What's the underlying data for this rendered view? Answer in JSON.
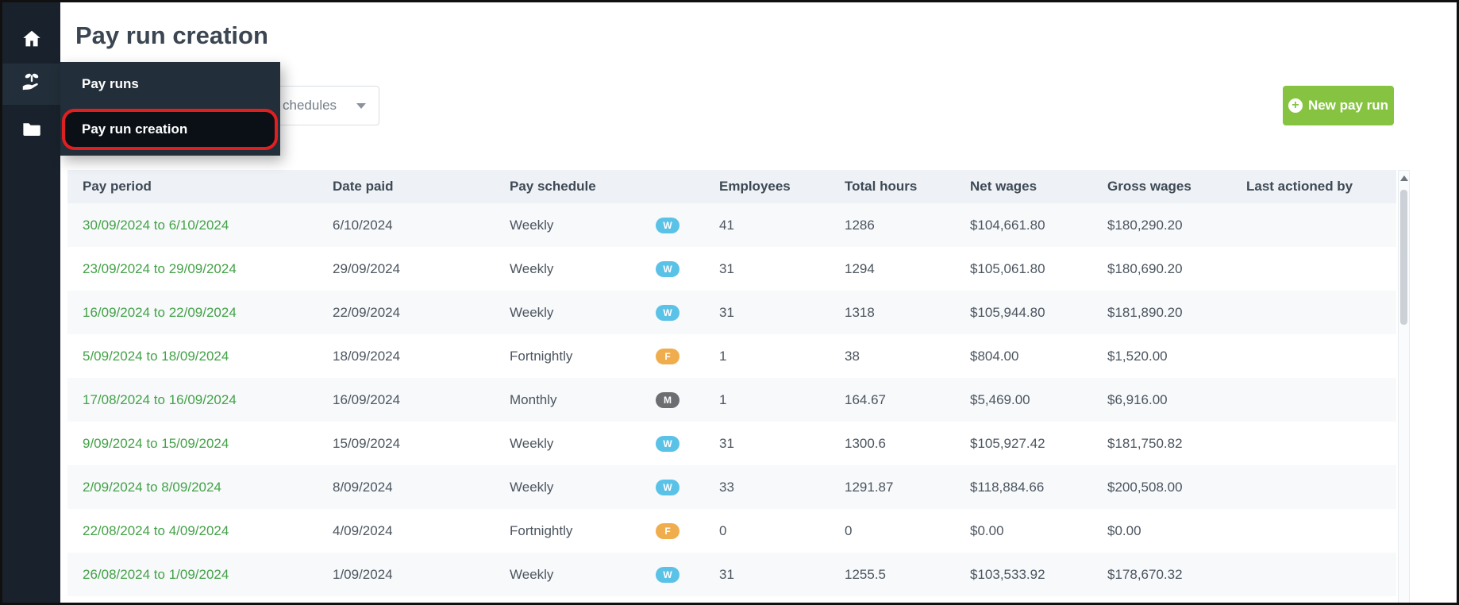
{
  "page": {
    "title": "Pay run creation"
  },
  "sidebar": {
    "icons": [
      "home-icon",
      "payroll-hand-icon",
      "folder-icon"
    ]
  },
  "flyout": {
    "items": [
      {
        "label": "Pay runs",
        "highlighted": false
      },
      {
        "label": "Pay run creation",
        "highlighted": true
      }
    ]
  },
  "toolbar": {
    "schedule_filter_visible_text": "chedules",
    "new_pay_run_label": "New pay run"
  },
  "table": {
    "columns": [
      "Pay period",
      "Date paid",
      "Pay schedule",
      "Employees",
      "Total hours",
      "Net wages",
      "Gross wages",
      "Last actioned by"
    ],
    "badge_colors": {
      "W": "#5bc2e7",
      "F": "#f0ad4e",
      "M": "#6d6e71"
    },
    "rows": [
      {
        "pay_period": "30/09/2024 to 6/10/2024",
        "date_paid": "6/10/2024",
        "schedule": "Weekly",
        "badge": "W",
        "employees": "41",
        "total_hours": "1286",
        "net_wages": "$104,661.80",
        "gross_wages": "$180,290.20",
        "last_actioned_by": ""
      },
      {
        "pay_period": "23/09/2024 to 29/09/2024",
        "date_paid": "29/09/2024",
        "schedule": "Weekly",
        "badge": "W",
        "employees": "31",
        "total_hours": "1294",
        "net_wages": "$105,061.80",
        "gross_wages": "$180,690.20",
        "last_actioned_by": ""
      },
      {
        "pay_period": "16/09/2024 to 22/09/2024",
        "date_paid": "22/09/2024",
        "schedule": "Weekly",
        "badge": "W",
        "employees": "31",
        "total_hours": "1318",
        "net_wages": "$105,944.80",
        "gross_wages": "$181,890.20",
        "last_actioned_by": ""
      },
      {
        "pay_period": "5/09/2024 to 18/09/2024",
        "date_paid": "18/09/2024",
        "schedule": "Fortnightly",
        "badge": "F",
        "employees": "1",
        "total_hours": "38",
        "net_wages": "$804.00",
        "gross_wages": "$1,520.00",
        "last_actioned_by": ""
      },
      {
        "pay_period": "17/08/2024 to 16/09/2024",
        "date_paid": "16/09/2024",
        "schedule": "Monthly",
        "badge": "M",
        "employees": "1",
        "total_hours": "164.67",
        "net_wages": "$5,469.00",
        "gross_wages": "$6,916.00",
        "last_actioned_by": ""
      },
      {
        "pay_period": "9/09/2024 to 15/09/2024",
        "date_paid": "15/09/2024",
        "schedule": "Weekly",
        "badge": "W",
        "employees": "31",
        "total_hours": "1300.6",
        "net_wages": "$105,927.42",
        "gross_wages": "$181,750.82",
        "last_actioned_by": ""
      },
      {
        "pay_period": "2/09/2024 to 8/09/2024",
        "date_paid": "8/09/2024",
        "schedule": "Weekly",
        "badge": "W",
        "employees": "33",
        "total_hours": "1291.87",
        "net_wages": "$118,884.66",
        "gross_wages": "$200,508.00",
        "last_actioned_by": ""
      },
      {
        "pay_period": "22/08/2024 to 4/09/2024",
        "date_paid": "4/09/2024",
        "schedule": "Fortnightly",
        "badge": "F",
        "employees": "0",
        "total_hours": "0",
        "net_wages": "$0.00",
        "gross_wages": "$0.00",
        "last_actioned_by": ""
      },
      {
        "pay_period": "26/08/2024 to 1/09/2024",
        "date_paid": "1/09/2024",
        "schedule": "Weekly",
        "badge": "W",
        "employees": "31",
        "total_hours": "1255.5",
        "net_wages": "$103,533.92",
        "gross_wages": "$178,670.32",
        "last_actioned_by": ""
      }
    ]
  },
  "colors": {
    "accent_green": "#44a248",
    "button_green": "#85c341",
    "highlight_red": "#e02020"
  }
}
